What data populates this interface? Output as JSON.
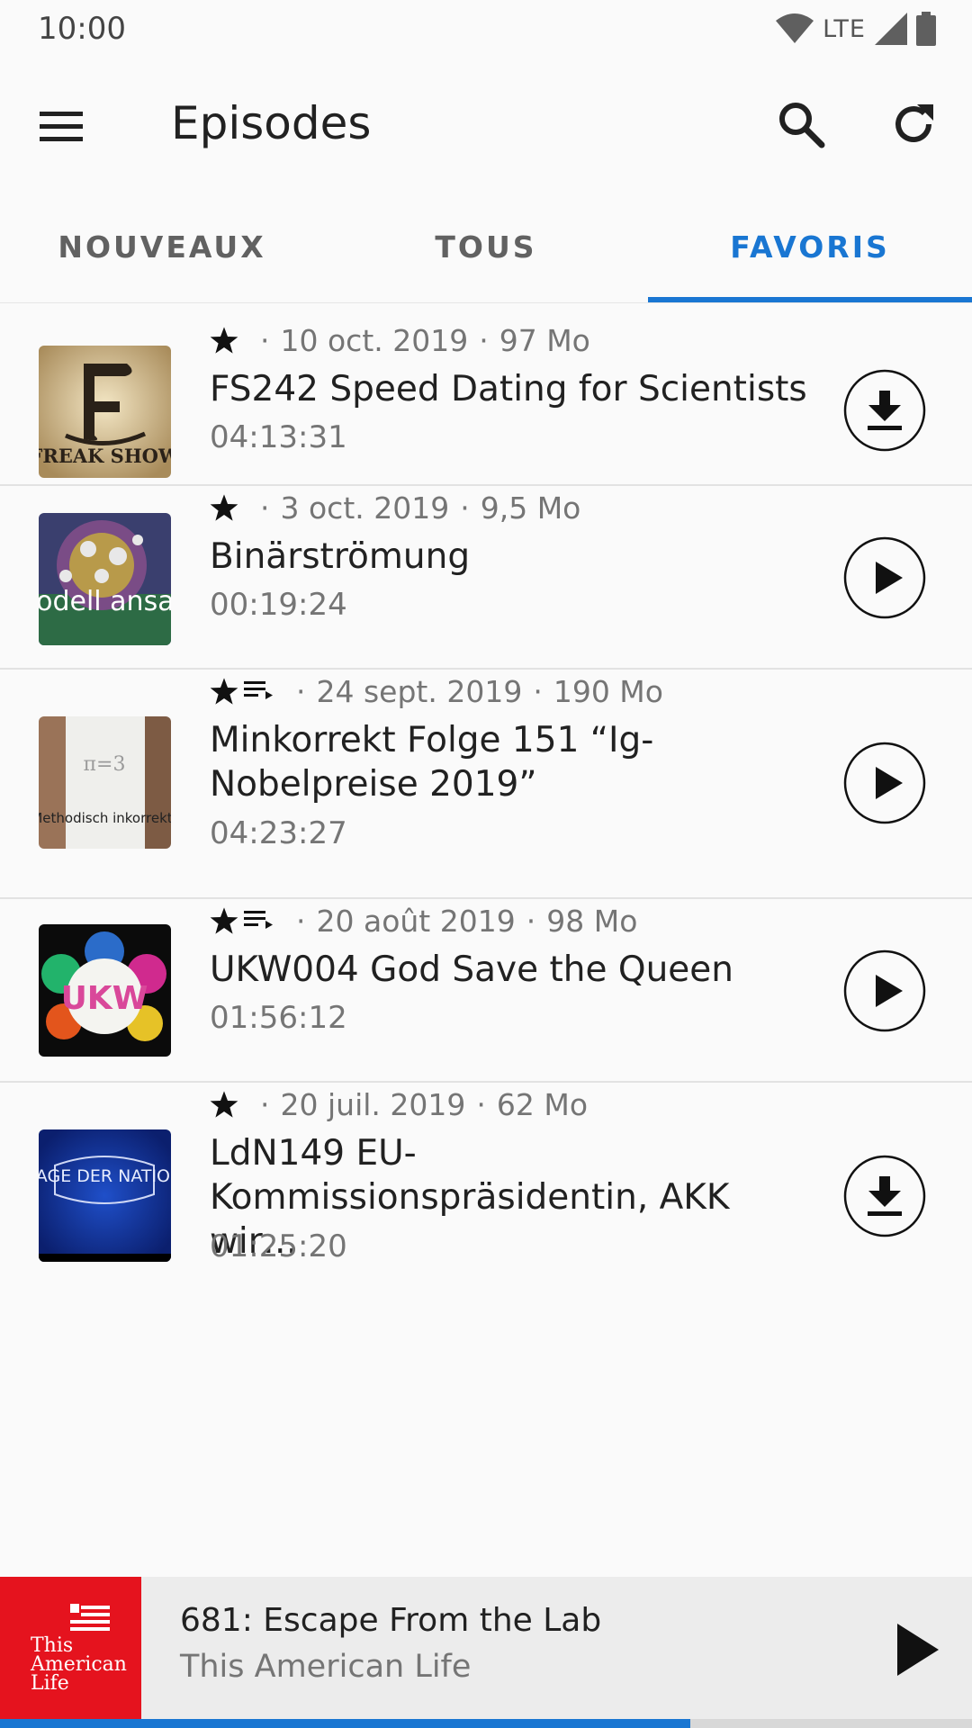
{
  "status": {
    "time": "10:00",
    "network": "LTE"
  },
  "header": {
    "title": "Episodes"
  },
  "tabs": [
    {
      "label": "NOUVEAUX",
      "active": false
    },
    {
      "label": "TOUS",
      "active": false
    },
    {
      "label": "FAVORIS",
      "active": true
    }
  ],
  "episodes": [
    {
      "date": "10 oct. 2019",
      "size": "97 Mo",
      "title": "FS242 Speed Dating for Scientists",
      "duration": "04:13:31",
      "action": "download-icon",
      "queued": false,
      "cover_text": "FREAK SHOW"
    },
    {
      "date": "3 oct. 2019",
      "size": "9,5 Mo",
      "title": "Binärströmung",
      "duration": "00:19:24",
      "action": "play-icon",
      "queued": false,
      "cover_text": "modell ansatz"
    },
    {
      "date": "24 sept. 2019",
      "size": "190 Mo",
      "title": "Minkorrekt Folge 151 “Ig-Nobelpreise 2019”",
      "duration": "04:23:27",
      "action": "play-icon",
      "queued": true,
      "cover_text": "Methodisch inkorrekt!"
    },
    {
      "date": "20 août 2019",
      "size": "98 Mo",
      "title": "UKW004 God Save the Queen",
      "duration": "01:56:12",
      "action": "play-icon",
      "queued": true,
      "cover_text": "UKW"
    },
    {
      "date": "20 juil. 2019",
      "size": "62 Mo",
      "title": "LdN149 EU-Kommissionspräsidentin, AKK wir…",
      "duration": "01:25:20",
      "action": "download-icon",
      "queued": false,
      "cover_text": "LAGE DER NATION"
    }
  ],
  "player": {
    "title": "681: Escape From the Lab",
    "podcast": "This American Life",
    "cover_text": "This American Life",
    "progress": 0.71
  },
  "colors": {
    "accent": "#1976d2",
    "player_cover": "#e5131e"
  }
}
